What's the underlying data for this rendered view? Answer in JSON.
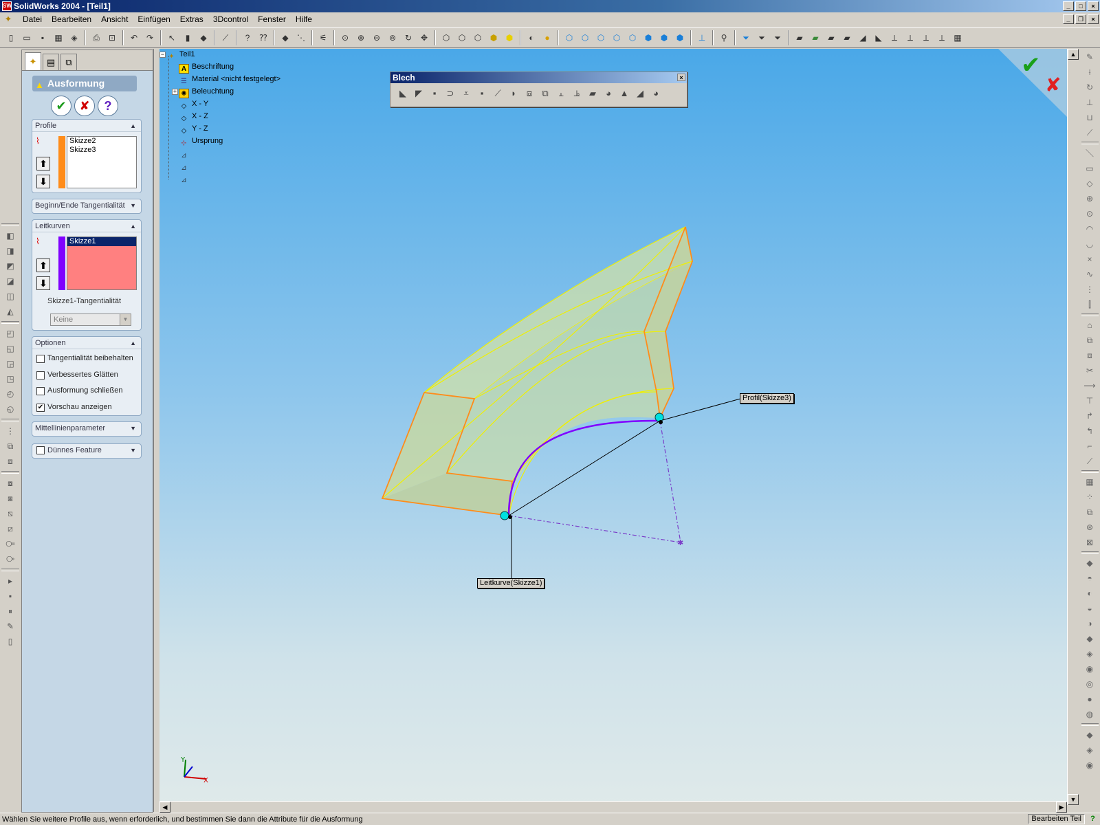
{
  "window": {
    "title": "SolidWorks 2004 - [Teil1]"
  },
  "menu": [
    "Datei",
    "Bearbeiten",
    "Ansicht",
    "Einfügen",
    "Extras",
    "3Dcontrol",
    "Fenster",
    "Hilfe"
  ],
  "propertymanager": {
    "title": "Ausformung",
    "profile": {
      "header": "Profile",
      "items": [
        "Skizze2",
        "Skizze3"
      ],
      "color": "#ff8c1a"
    },
    "tangency_group": {
      "header": "Beginn/Ende Tangentialität"
    },
    "guides": {
      "header": "Leitkurven",
      "items": [
        "Skizze1"
      ],
      "color": "#8000ff",
      "list_bg": "#ff8080",
      "tangency_label": "Skizze1-Tangentialität",
      "tangency_value": "Keine"
    },
    "options": {
      "header": "Optionen",
      "items": [
        {
          "label": "Tangentialität beibehalten",
          "checked": false
        },
        {
          "label": "Verbessertes Glätten",
          "checked": false
        },
        {
          "label": "Ausformung schließen",
          "checked": false
        },
        {
          "label": "Vorschau anzeigen",
          "checked": true
        }
      ]
    },
    "centerline": {
      "header": "Mittellinienparameter"
    },
    "thin": {
      "header": "Dünnes Feature"
    }
  },
  "feature_tree": {
    "root": "Teil1",
    "nodes": [
      "Beschriftung",
      "Material <nicht festgelegt>",
      "Beleuchtung",
      "X - Y",
      "X - Z",
      "Y - Z",
      "Ursprung"
    ]
  },
  "blech_toolbar": {
    "title": "Blech"
  },
  "viewport": {
    "labels": {
      "profile": "Profil(Skizze3)",
      "guide": "Leitkurve(Skizze1)"
    },
    "triad": {
      "x": "X",
      "y": "Y"
    }
  },
  "status": {
    "message": "Wählen Sie weitere Profile aus, wenn erforderlich, und bestimmen Sie dann die Attribute für die Ausformung",
    "mode": "Bearbeiten Teil"
  }
}
